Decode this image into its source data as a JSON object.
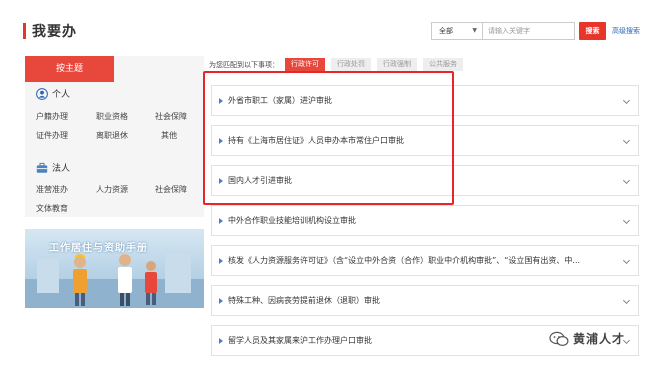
{
  "header": {
    "title": "我要办"
  },
  "search": {
    "scope_value": "全部",
    "keyword_placeholder": "请输入关键字",
    "search_label": "搜索",
    "advanced_label": "高级搜索"
  },
  "left": {
    "theme_tab": "按主题",
    "personal": {
      "heading": "个人",
      "links": [
        "户籍办理",
        "职业资格",
        "社会保障",
        "证件办理",
        "离职退休",
        "其他"
      ]
    },
    "legal": {
      "heading": "法人",
      "links": [
        "准营准办",
        "人力资源",
        "社会保障",
        "文体教育"
      ]
    },
    "banner_title": "工作居住与资助手册"
  },
  "filter": {
    "label": "为您匹配到以下事项：",
    "chips": [
      "行政许可",
      "行政处罚",
      "行政强制",
      "公共服务"
    ],
    "active_index": 0
  },
  "items": [
    "外省市职工（家属）进沪审批",
    "持有《上海市居住证》人员申办本市常住户口审批",
    "国内人才引进审批",
    "中外合作职业技能培训机构设立审批",
    "核发《人力资源服务许可证》（含“设立中外合资（合作）职业中介机构审批”、“设立国有出资、中...",
    "特殊工种、因病丧劳提前退休（退职）审批",
    "留学人员及其家属来沪工作办理户口审批"
  ],
  "watermark": {
    "text": "黄浦人才"
  },
  "colors": {
    "accent": "#e8352a",
    "link_blue": "#2b63b3",
    "triangle_blue": "#4f81bd"
  },
  "icons": {
    "personal": "person-icon",
    "legal": "briefcase-icon",
    "chevron": "chevron-down-icon",
    "wechat": "wechat-icon"
  }
}
